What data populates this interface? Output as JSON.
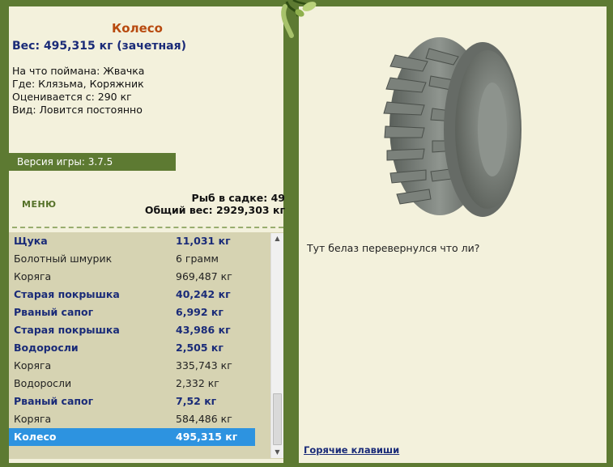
{
  "catch": {
    "name": "Колесо",
    "weight": "Вес: 495,315 кг (зачетная)",
    "caught_on": "На что поймана: Жвачка",
    "location": "Где: Клязьма, Коряжник",
    "price": "Оценивается с: 290 кг",
    "kind": "Вид: Ловится постоянно",
    "comment": "Тут белаз перевернулся что ли?"
  },
  "version": "Версия игры: 3.7.5",
  "menu_label": "МЕНЮ",
  "stats": {
    "fish_count": "Рыб в садке: 49",
    "total_weight": "Общий вес: 2929,303 кг"
  },
  "list": [
    {
      "name": "Щука",
      "weight": "11,031 кг",
      "style": "bold"
    },
    {
      "name": "Болотный шмурик",
      "weight": "6 грамм",
      "style": "normal"
    },
    {
      "name": "Коряга",
      "weight": "969,487 кг",
      "style": "normal"
    },
    {
      "name": "Старая покрышка",
      "weight": "40,242 кг",
      "style": "bold"
    },
    {
      "name": "Рваный сапог",
      "weight": "6,992 кг",
      "style": "bold"
    },
    {
      "name": "Старая покрышка",
      "weight": "43,986 кг",
      "style": "bold"
    },
    {
      "name": "Водоросли",
      "weight": "2,505 кг",
      "style": "bold"
    },
    {
      "name": "Коряга",
      "weight": "335,743 кг",
      "style": "normal"
    },
    {
      "name": "Водоросли",
      "weight": "2,332 кг",
      "style": "normal"
    },
    {
      "name": "Рваный сапог",
      "weight": "7,52 кг",
      "style": "bold"
    },
    {
      "name": "Коряга",
      "weight": "584,486 кг",
      "style": "normal"
    },
    {
      "name": "Колесо",
      "weight": "495,315 кг",
      "style": "sel"
    }
  ],
  "hotkeys_label": "Горячие клавиши",
  "icons": {
    "scroll_up": "scroll-up-arrow",
    "scroll_down": "scroll-down-arrow",
    "vine": "vine-ornament",
    "tire": "tire-image"
  },
  "colors": {
    "frame": "#5d7a32",
    "panel": "#f3f1dc",
    "list_bg": "#d6d3b2",
    "selected": "#2d93e0",
    "title": "#b84a0f",
    "bold_text": "#1a2b78"
  }
}
